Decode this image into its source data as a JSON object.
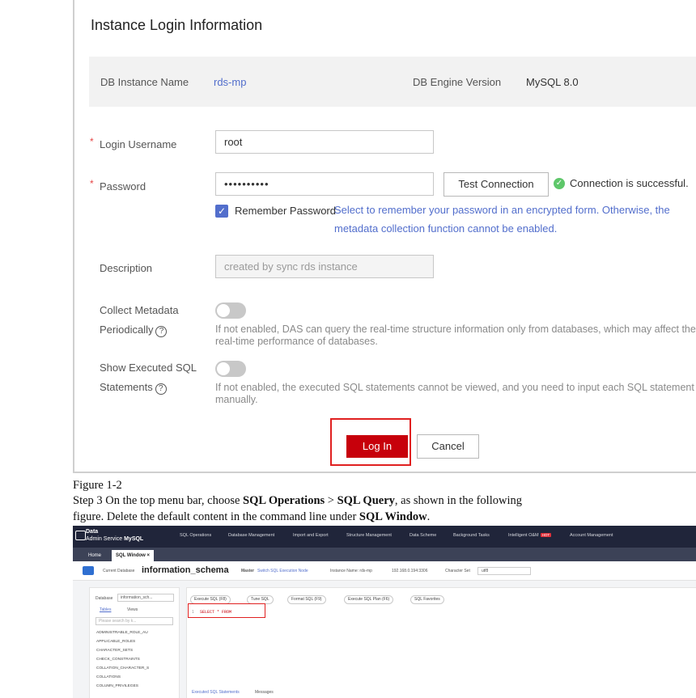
{
  "dialog": {
    "title": "Instance Login Information",
    "db_instance_name_label": "DB Instance Name",
    "db_instance_name": "rds-mp",
    "db_engine_version_label": "DB Engine Version",
    "db_engine_version": "MySQL 8.0",
    "required_mark": "*",
    "login_username_label": "Login Username",
    "login_username_value": "root",
    "password_label": "Password",
    "password_value": "••••••••••",
    "test_connection_label": "Test Connection",
    "connection_status": "Connection is successful.",
    "remember_password_label": "Remember Password",
    "remember_note_line1": "Select to remember your password in an encrypted form. Otherwise, the",
    "remember_note_line2": "metadata collection function cannot be enabled.",
    "description_label": "Description",
    "description_placeholder": "created by sync rds instance",
    "collect_metadata_label_line1": "Collect Metadata",
    "collect_metadata_label_line2": "Periodically",
    "collect_metadata_note_line1": "If not enabled, DAS can query the real-time structure information only from databases, which may affect the",
    "collect_metadata_note_line2": "real-time performance of databases.",
    "show_sql_label_line1": "Show Executed SQL",
    "show_sql_label_line2": "Statements",
    "show_sql_note_line1": "If not enabled, the executed SQL statements cannot be viewed, and you need to input each SQL statement",
    "show_sql_note_line2": "manually.",
    "login_button": "Log In",
    "cancel_button": "Cancel",
    "help_glyph": "?",
    "check_glyph": "✓"
  },
  "doc": {
    "figure_caption": "Figure 1-2",
    "step_prefix": "Step 3 On the top menu bar, choose ",
    "step_bold1": "SQL Operations",
    "step_sep": " > ",
    "step_bold2": "SQL Query",
    "step_mid": ", as shown in the following",
    "step_line2_prefix": "figure. Delete the default content in the command line under ",
    "step_bold3": "SQL Window",
    "step_end": "."
  },
  "screenshot": {
    "brand_line1": "Data",
    "brand_line2": "Admin Service",
    "brand_engine": "MySQL",
    "menu": [
      "SQL Operations",
      "Database Management",
      "Import and Export",
      "Structure Management",
      "Data Scheme",
      "Background Tasks",
      "Intelligent O&M",
      "Account Management"
    ],
    "hot_badge": "HOT",
    "tabs": [
      "Home",
      "SQL Window"
    ],
    "tab_close": "×",
    "current_db_label": "Current Database",
    "current_db": "information_schema",
    "master_label": "Master",
    "switch_node": "Switch SQL Execution Node",
    "instance_name": "Instance Name: rds-mp",
    "address": "192.168.0.194:3306",
    "charset_label": "Character Set",
    "charset_value": "utf8",
    "database_label": "Database",
    "database_value": "information_sch...",
    "left_tabs": [
      "Tables",
      "Views"
    ],
    "search_placeholder": "Please search by k...",
    "tables": [
      "ADMINISTRABLE_ROLE_AU",
      "APPLICABLE_ROLES",
      "CHARACTER_SETS",
      "CHECK_CONSTRAINTS",
      "COLLATION_CHARACTER_S",
      "COLLATIONS",
      "COLUMN_PRIVILEGES"
    ],
    "toolbar": [
      "Execute SQL (F8)",
      "Tune SQL",
      "Format SQL (F9)",
      "Execute SQL Plan (F6)",
      "SQL Favorites"
    ],
    "editor_line_no": "1",
    "editor_sql": "SELECT * FROM",
    "bottom_tabs": [
      "Executed SQL Statements",
      "Messages"
    ]
  },
  "colors": {
    "accent_blue": "#526ecc",
    "login_red": "#c7000b",
    "success_green": "#5ec76a",
    "highlight_red": "#e02020",
    "topbar_dark": "#20253a"
  }
}
